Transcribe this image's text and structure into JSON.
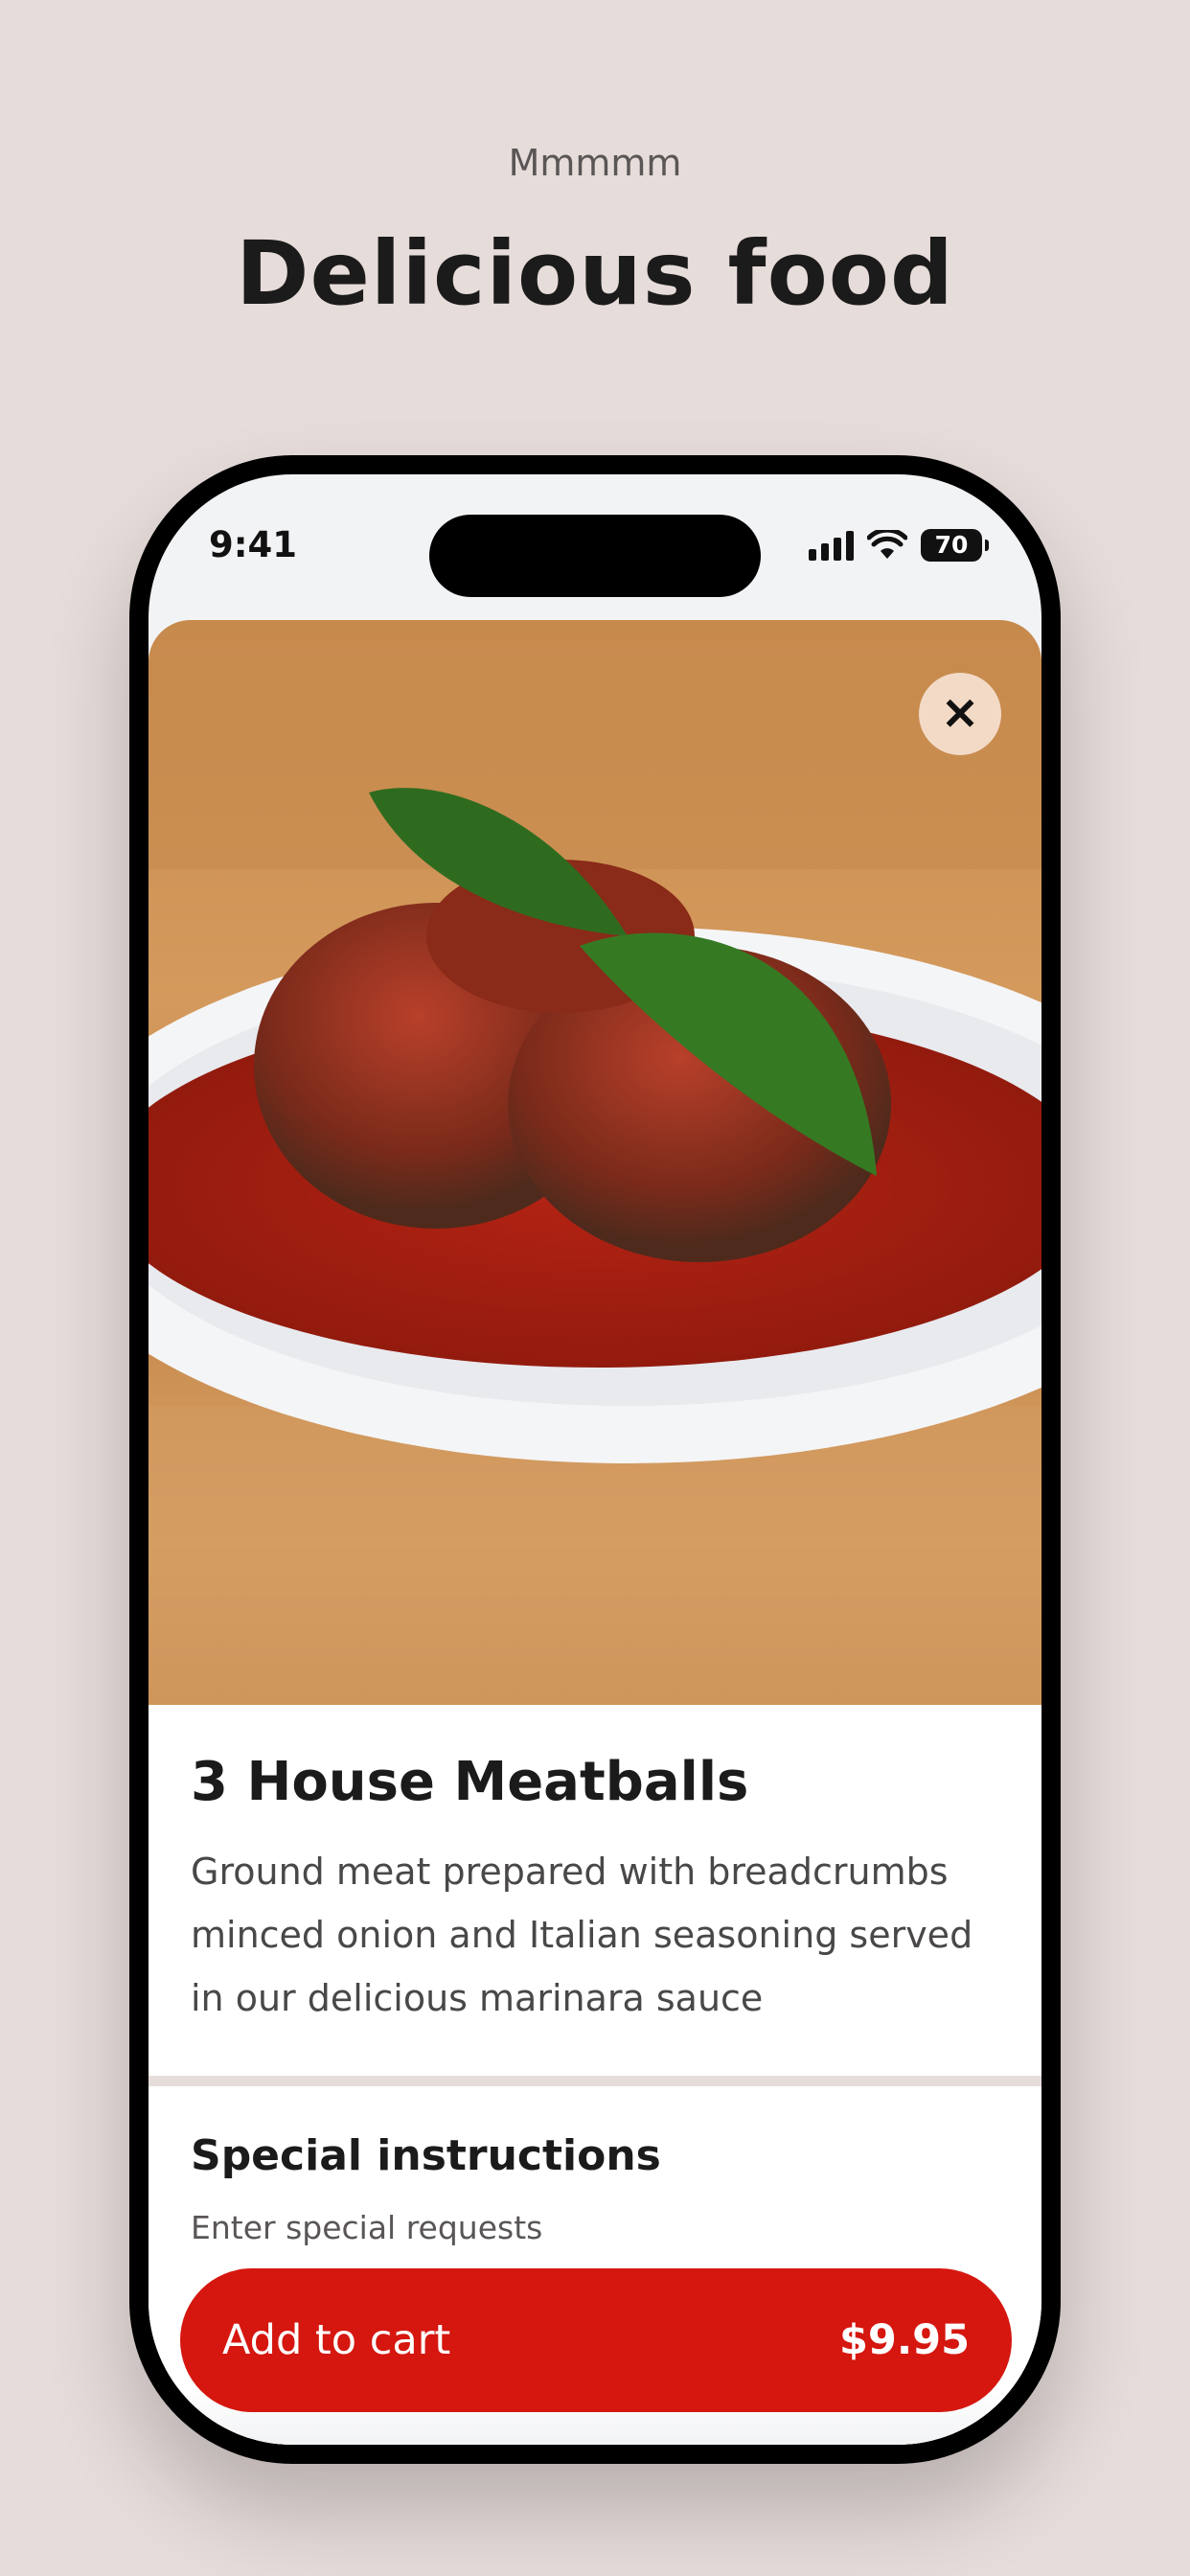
{
  "intro": {
    "eyebrow": "Mmmmm",
    "headline": "Delicious food"
  },
  "status_bar": {
    "time": "9:41",
    "battery": "70"
  },
  "item": {
    "title": "3 House Meatballs",
    "description": "Ground meat prepared with breadcrumbs minced onion and Italian seasoning served in our delicious marinara sauce"
  },
  "special_instructions": {
    "title": "Special instructions",
    "placeholder": "Enter special requests"
  },
  "cart": {
    "label": "Add to cart",
    "price": "$9.95"
  },
  "icons": {
    "close": "close-icon",
    "signal": "signal-icon",
    "wifi": "wifi-icon",
    "battery": "battery-icon"
  },
  "colors": {
    "accent": "#d5170f",
    "background": "#e6dcda"
  }
}
